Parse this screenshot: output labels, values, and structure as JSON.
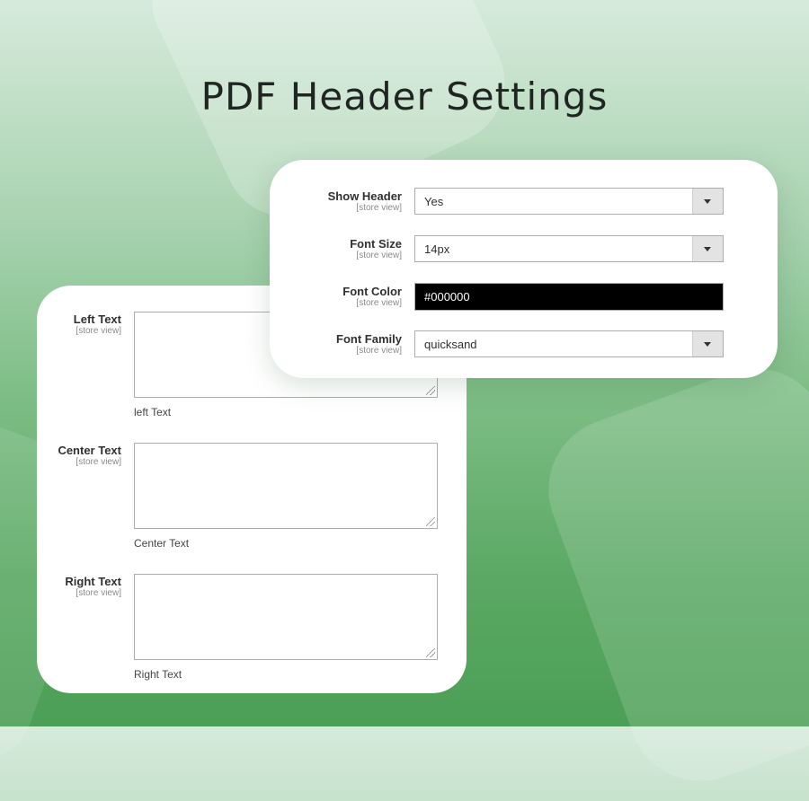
{
  "title": "PDF Header Settings",
  "header_settings": {
    "fields": [
      {
        "label": "Show Header",
        "scope": "[store view]",
        "type": "select",
        "value": "Yes"
      },
      {
        "label": "Font Size",
        "scope": "[store view]",
        "type": "select",
        "value": "14px"
      },
      {
        "label": "Font Color",
        "scope": "[store view]",
        "type": "color",
        "value": "#000000"
      },
      {
        "label": "Font Family",
        "scope": "[store view]",
        "type": "select",
        "value": "quicksand"
      }
    ]
  },
  "text_settings": {
    "fields": [
      {
        "label": "Left Text",
        "scope": "[store view]",
        "value": "",
        "note": "left Text"
      },
      {
        "label": "Center Text",
        "scope": "[store view]",
        "value": "",
        "note": "Center Text"
      },
      {
        "label": "Right Text",
        "scope": "[store view]",
        "value": "",
        "note": "Right Text"
      }
    ]
  },
  "colors": {
    "background_top": "#d6eadb",
    "background_bottom": "#4c9f56",
    "font_color_swatch": "#000000"
  }
}
